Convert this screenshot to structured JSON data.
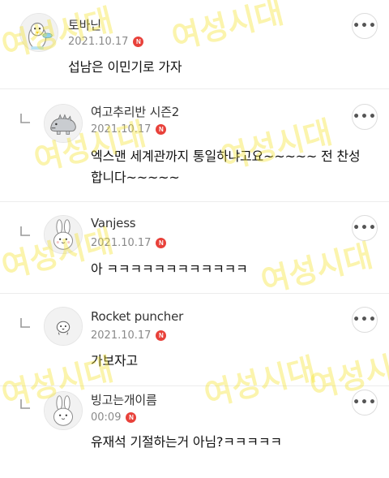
{
  "comments": [
    {
      "author": "토바닌",
      "date": "2021.10.17",
      "badge": "N",
      "text": "섭남은 이민기로 가자",
      "is_reply": false,
      "avatar_icon": "penguin-avatar-icon"
    },
    {
      "author": "여고추리반 시즌2",
      "date": "2021.10.17",
      "badge": "N",
      "text_line1": "엑스맨 세계관까지 통일하냐고요~~~~~ 전 찬성",
      "text_line2": "합니다~~~~~",
      "is_reply": true,
      "avatar_icon": "dinosaur-avatar-icon"
    },
    {
      "author": "Vanjess",
      "date": "2021.10.17",
      "badge": "N",
      "text": "아 ㅋㅋㅋㅋㅋㅋㅋㅋㅋㅋㅋㅋ",
      "is_reply": true,
      "avatar_icon": "bunny-avatar-icon"
    },
    {
      "author": "Rocket puncher",
      "date": "2021.10.17",
      "badge": "N",
      "text": "가보자고",
      "is_reply": true,
      "avatar_icon": "bird-avatar-icon"
    },
    {
      "author": "빙고는개이름",
      "date": "00:09",
      "badge": "N",
      "text": "유재석 기절하는거 아님?ㅋㅋㅋㅋㅋ",
      "is_reply": true,
      "avatar_icon": "bunny-avatar-icon"
    }
  ],
  "more_label": "•••",
  "watermark_text": "여성시대",
  "colors": {
    "badge": "#e8413a",
    "watermark": "#f5e128"
  }
}
